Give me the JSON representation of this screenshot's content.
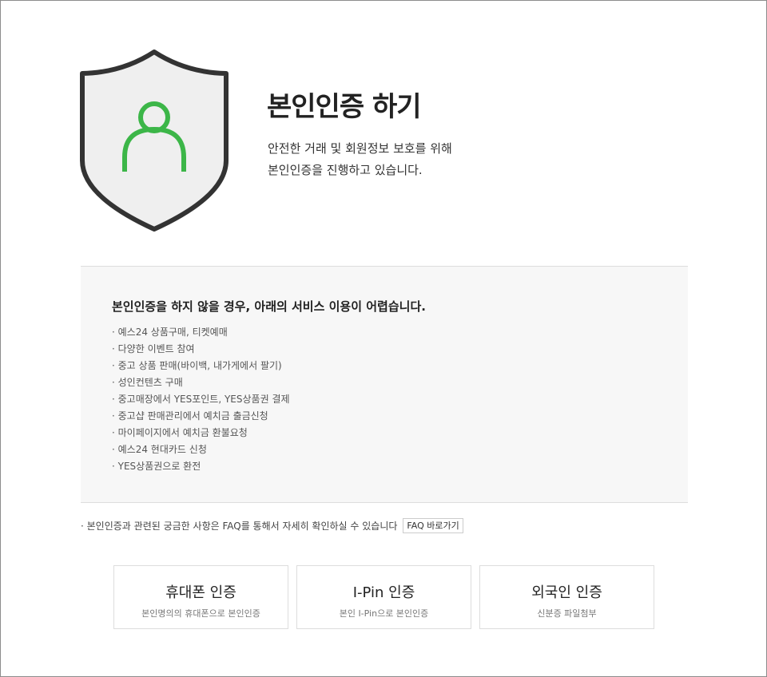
{
  "header": {
    "title": "본인인증 하기",
    "subtitle_lines": [
      "안전한 거래 및 회원정보 보호를 위해",
      "본인인증을 진행하고 있습니다."
    ]
  },
  "icons": {
    "shield": "shield-user-icon",
    "shield_fill": "#efefef",
    "shield_stroke": "#333333",
    "person_color": "#3cb648"
  },
  "notice": {
    "heading": "본인인증을 하지 않을 경우, 아래의 서비스 이용이 어렵습니다.",
    "items": [
      "예스24 상품구매, 티켓예매",
      "다양한 이벤트 참여",
      "중고 상품 판매(바이백, 내가게에서 팔기)",
      "성인컨텐츠 구매",
      "중고매장에서 YES포인트, YES상품권 결제",
      "중고샵 판매관리에서 예치금 출금신청",
      "마이페이지에서 예치금 환불요청",
      "예스24 현대카드 신청",
      "YES상품권으로 환전"
    ]
  },
  "faq": {
    "text": "본인인증과 관련된 궁금한 사항은 FAQ를 통해서 자세히 확인하실 수 있습니다",
    "button_label": "FAQ 바로가기"
  },
  "methods": [
    {
      "title": "휴대폰 인증",
      "desc": "본인명의의 휴대폰으로 본인인증"
    },
    {
      "title": "I-Pin 인증",
      "desc": "본인 I-Pin으로 본인인증"
    },
    {
      "title": "외국인 인증",
      "desc": "신분증 파일첨부"
    }
  ]
}
